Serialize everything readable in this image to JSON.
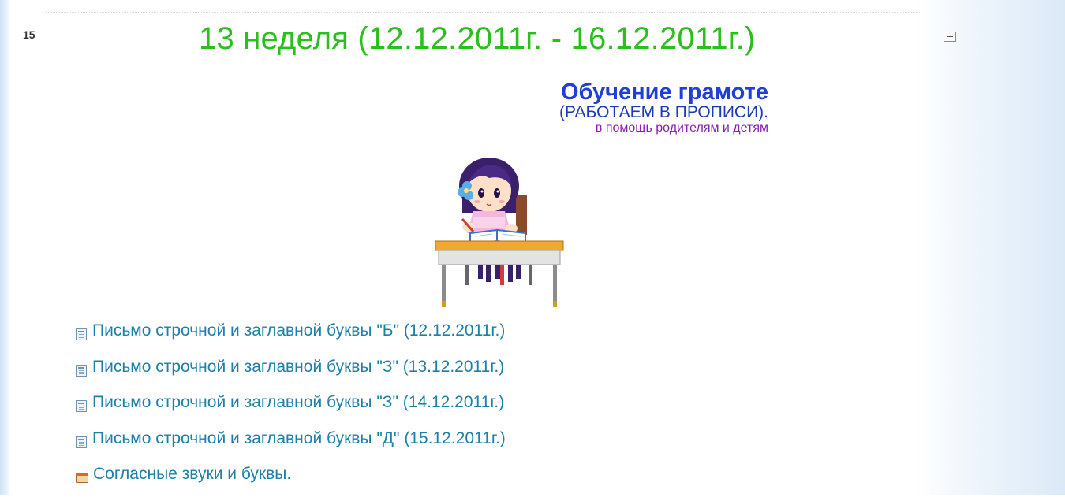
{
  "section": {
    "number": "15",
    "week_title": "13 неделя (12.12.2011г. - 16.12.2011г.)",
    "collapse_icon": "collapse-minus-icon"
  },
  "header_block": {
    "subject": "Обучение грамоте",
    "note1": "(РАБОТАЕМ В ПРОПИСИ).",
    "note2": "в помощь родителям и детям"
  },
  "colors": {
    "week_title": "#2bbf1d",
    "subject": "#1f3fd6",
    "note2": "#8a1fb0",
    "link": "#1d80a8"
  },
  "resources": [
    {
      "label": "Письмо строчной и заглавной буквы \"Б\" (12.12.2011г.)",
      "icon": "document-icon"
    },
    {
      "label": "Письмо строчной и заглавной буквы \"З\" (13.12.2011г.)",
      "icon": "document-icon"
    },
    {
      "label": "Письмо строчной и заглавной буквы \"З\" (14.12.2011г.)",
      "icon": "document-icon"
    },
    {
      "label": "Письмо строчной и заглавной буквы \"Д\" (15.12.2011г.)",
      "icon": "document-icon"
    },
    {
      "label": "Согласные звуки и буквы.",
      "icon": "folder-icon"
    }
  ]
}
